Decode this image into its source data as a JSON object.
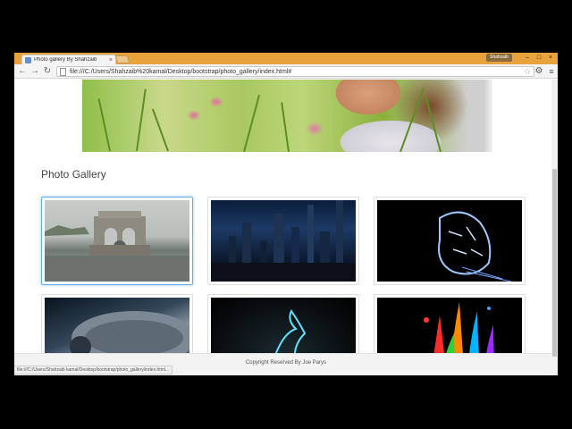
{
  "browser": {
    "tab_title": "Photo gallery By Shahzaib",
    "tab_close": "×",
    "user_badge": "Shahzaib",
    "minimize": "–",
    "maximize": "□",
    "close": "×",
    "back": "←",
    "forward": "→",
    "reload": "↻",
    "url": "file:///C:/Users/Shahzaib%20kamal/Desktop/bootstrap/photo_gallery/index.html#",
    "star": "☆",
    "settings": "⚙",
    "menu": "≡",
    "status_url": "file:///C:/Users/Shahzaib kamal/Desktop/bootstrap/photo_gallery/index.html..."
  },
  "page": {
    "gallery_heading": "Photo Gallery",
    "footer_text": "Copyright Reserved By Joe Parys"
  },
  "thumbnails": [
    {
      "icon": "ruins-in-water-photo"
    },
    {
      "icon": "night-city-photo"
    },
    {
      "icon": "glowing-tiger-photo"
    },
    {
      "icon": "spaceship-photo"
    },
    {
      "icon": "neon-dragon-photo"
    },
    {
      "icon": "paint-splash-photo"
    }
  ]
}
